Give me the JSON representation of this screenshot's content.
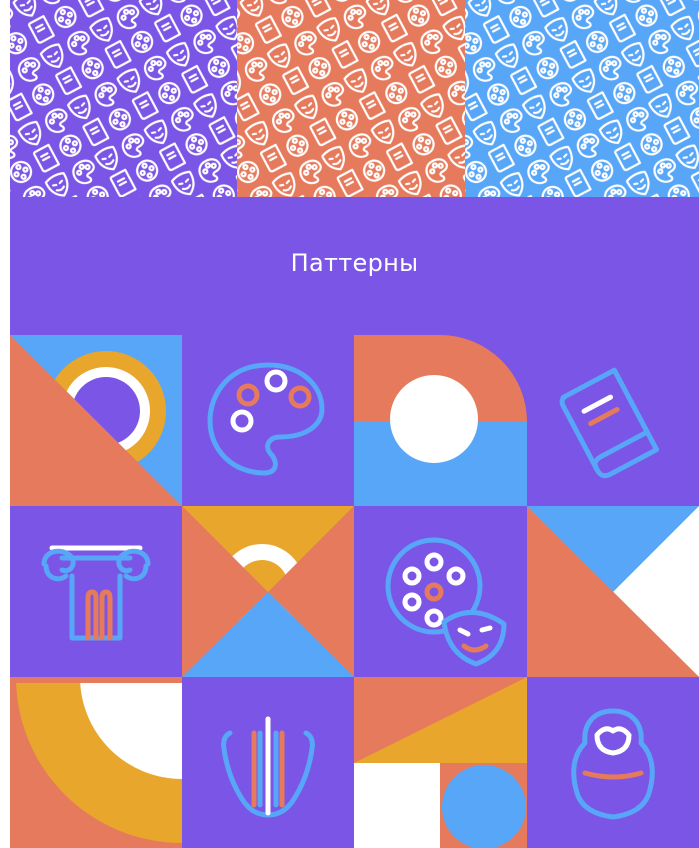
{
  "title": "Паттерны",
  "palette": {
    "violet": "#7b55e6",
    "coral": "#e67a5c",
    "sky": "#58a6f7",
    "gold": "#e8a62c",
    "white": "#ffffff"
  },
  "patterns": [
    {
      "name": "violet-pattern",
      "background": "#7b55e6"
    },
    {
      "name": "coral-pattern",
      "background": "#e67a5c"
    },
    {
      "name": "blue-pattern",
      "background": "#58a6f7"
    }
  ],
  "icons": [
    "palette-icon",
    "book-icon",
    "column-icon",
    "film-reel-icon",
    "theater-mask-icon",
    "lyre-icon",
    "matryoshka-icon"
  ]
}
